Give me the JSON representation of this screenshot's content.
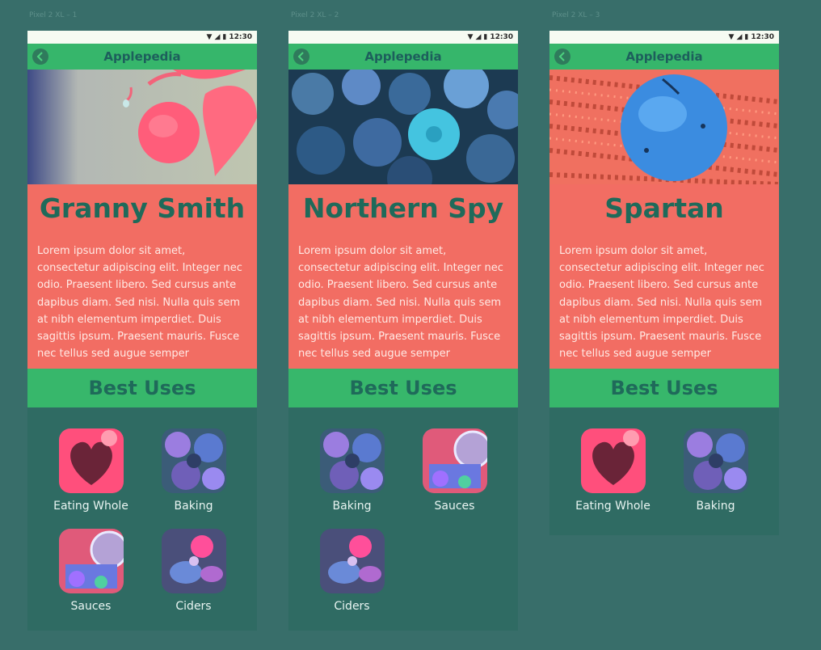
{
  "frame_labels": [
    "Pixel 2 XL – 1",
    "Pixel 2 XL – 2",
    "Pixel 2 XL – 3"
  ],
  "status": {
    "time": "12:30"
  },
  "app_title": "Applepedia",
  "section_title": "Best Uses",
  "description": "Lorem ipsum dolor sit amet, consectetur adipiscing elit. Integer nec odio. Praesent libero. Sed cursus ante dapibus diam. Sed nisi. Nulla quis sem at nibh elementum imperdiet. Duis sagittis ipsum. Praesent mauris. Fusce nec tellus sed augue semper",
  "phones": [
    {
      "name": "Granny Smith",
      "hero": "leaf-apple",
      "uses": [
        {
          "label": "Eating Whole",
          "img": "eating"
        },
        {
          "label": "Baking",
          "img": "baking"
        },
        {
          "label": "Sauces",
          "img": "sauces"
        },
        {
          "label": "Ciders",
          "img": "ciders"
        }
      ]
    },
    {
      "name": "Northern Spy",
      "hero": "apple-pile",
      "uses": [
        {
          "label": "Baking",
          "img": "baking"
        },
        {
          "label": "Sauces",
          "img": "sauces"
        },
        {
          "label": "Ciders",
          "img": "ciders"
        }
      ]
    },
    {
      "name": "Spartan",
      "hero": "apple-ground",
      "uses": [
        {
          "label": "Eating Whole",
          "img": "eating"
        },
        {
          "label": "Baking",
          "img": "baking"
        }
      ]
    }
  ],
  "colors": {
    "background": "#386e6a",
    "appbar": "#36b66b",
    "red": "#f26d63",
    "title_text": "#1f6a5a"
  }
}
